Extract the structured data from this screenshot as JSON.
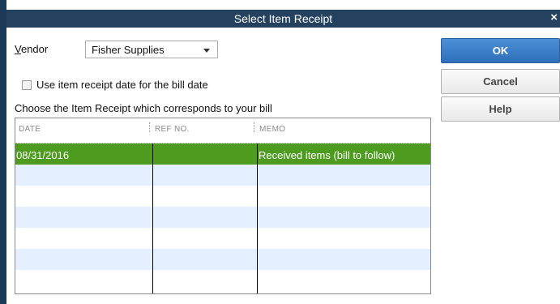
{
  "dialog": {
    "title": "Select Item Receipt",
    "close_glyph": "×"
  },
  "vendor": {
    "label_underlined": "V",
    "label_rest": "endor",
    "value": "Fisher Supplies"
  },
  "use_date_checkbox": {
    "label": "Use item receipt date for the bill date",
    "checked": false
  },
  "choose_label": "Choose the Item Receipt which corresponds to your bill",
  "table": {
    "columns": [
      "DATE",
      "REF NO.",
      "MEMO"
    ],
    "rows": [
      {
        "date": "08/31/2016",
        "ref_no": "",
        "memo": "Received items (bill to follow)"
      }
    ]
  },
  "buttons": {
    "ok": "OK",
    "cancel": "Cancel",
    "help": "Help"
  },
  "colors": {
    "title_bar": "#24425f",
    "selected_row": "#4d9b1f",
    "alt_row": "#e4efff",
    "ok_button": "#3a7fc8"
  },
  "icons": {
    "close": "close-icon",
    "dropdown": "chevron-down-icon"
  }
}
